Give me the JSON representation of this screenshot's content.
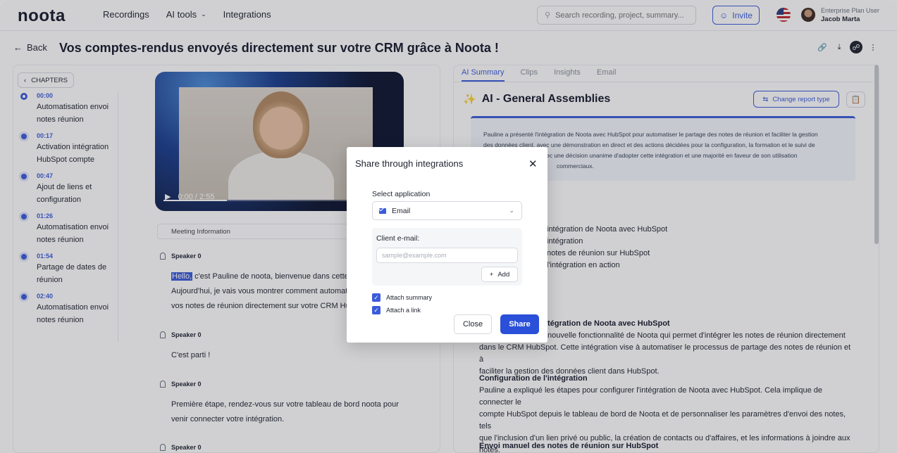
{
  "header": {
    "logo": "noota",
    "nav": [
      "Recordings",
      "AI tools",
      "Integrations"
    ],
    "search_placeholder": "Search recording, project, summary...",
    "invite_label": "Invite",
    "plan": "Enterprise Plan User",
    "user_name": "Jacob Marta"
  },
  "page": {
    "back_label": "Back",
    "title": "Vos comptes-rendus envoyés directement sur votre CRM grâce à Noota !"
  },
  "chapters": {
    "button_label": "CHAPTERS",
    "items": [
      {
        "time": "00:00",
        "label": "Automatisation envoi notes réunion"
      },
      {
        "time": "00:17",
        "label": "Activation intégration HubSpot compte"
      },
      {
        "time": "00:47",
        "label": "Ajout de liens et configuration"
      },
      {
        "time": "01:26",
        "label": "Automatisation envoi notes réunion"
      },
      {
        "time": "01:54",
        "label": "Partage de dates de réunion"
      },
      {
        "time": "02:40",
        "label": "Automatisation envoi notes réunion"
      }
    ]
  },
  "video": {
    "time": "0:00 / 2:55",
    "progress": 0.28
  },
  "transcript": {
    "meeting_info_label": "Meeting Information",
    "entries": [
      {
        "speaker": "Speaker 0",
        "highlight": "Hello,",
        "text": " c'est Pauline de noota, bienvenue dans cette no",
        "text2": "Aujourd'hui, je vais vous montrer comment automatis",
        "text3": "vos notes de réunion directement sur votre CRM Hub"
      },
      {
        "speaker": "Speaker 0",
        "text": "C'est parti !"
      },
      {
        "speaker": "Speaker 0",
        "text": "Première étape, rendez-vous sur votre tableau de bord noota pour",
        "text2": "venir connecter votre intégration."
      },
      {
        "speaker": "Speaker 0"
      }
    ]
  },
  "right": {
    "tabs": [
      "AI Summary",
      "Clips",
      "Insights",
      "Email"
    ],
    "title": "AI - General Assemblies",
    "change_report_label": "Change report type",
    "summary_lines": [
      "Pauline a présenté l'intégration de Noota avec HubSpot pour automatiser le partage des notes de réunion et faciliter la gestion",
      "des données client, avec une démonstration en direct et des actions décidées pour la configuration, la formation et le suivi de",
      "avec une décision unanime d'adopter cette intégration et une majorité en faveur de son utilisation",
      "commerciaux."
    ],
    "toc": [
      "intégration de Noota avec HubSpot",
      "intégration",
      "notes de réunion sur HubSpot",
      "l'intégration en action"
    ],
    "section1_head": "tégration de Noota avec HubSpot",
    "section1_body": [
      "nouvelle fonctionnalité de Noota qui permet d'intégrer les notes de réunion directement",
      "dans le CRM HubSpot. Cette intégration vise à automatiser le processus de partage des notes de réunion et à",
      "faciliter la gestion des données client dans HubSpot."
    ],
    "section2_head": "Configuration de l'intégration",
    "section2_body": [
      "Pauline a expliqué les étapes pour configurer l'intégration de Noota avec HubSpot. Cela implique de connecter le",
      "compte HubSpot depuis le tableau de bord de Noota et de personnaliser les paramètres d'envoi des notes, tels",
      "que l'inclusion d'un lien privé ou public, la création de contacts ou d'affaires, et les informations à joindre aux",
      "notes."
    ],
    "section3_head": "Envoi manuel des notes de réunion sur HubSpot"
  },
  "modal": {
    "title": "Share through integrations",
    "select_label": "Select application",
    "selected_app": "Email",
    "email_label": "Client e-mail:",
    "email_placeholder": "sample@example.com",
    "add_label": "Add",
    "attach_summary_label": "Attach summary",
    "attach_link_label": "Attach a link",
    "close_label": "Close",
    "share_label": "Share"
  },
  "colors": {
    "accent": "#3b5bdb",
    "share_button": "#2a4fd8"
  }
}
